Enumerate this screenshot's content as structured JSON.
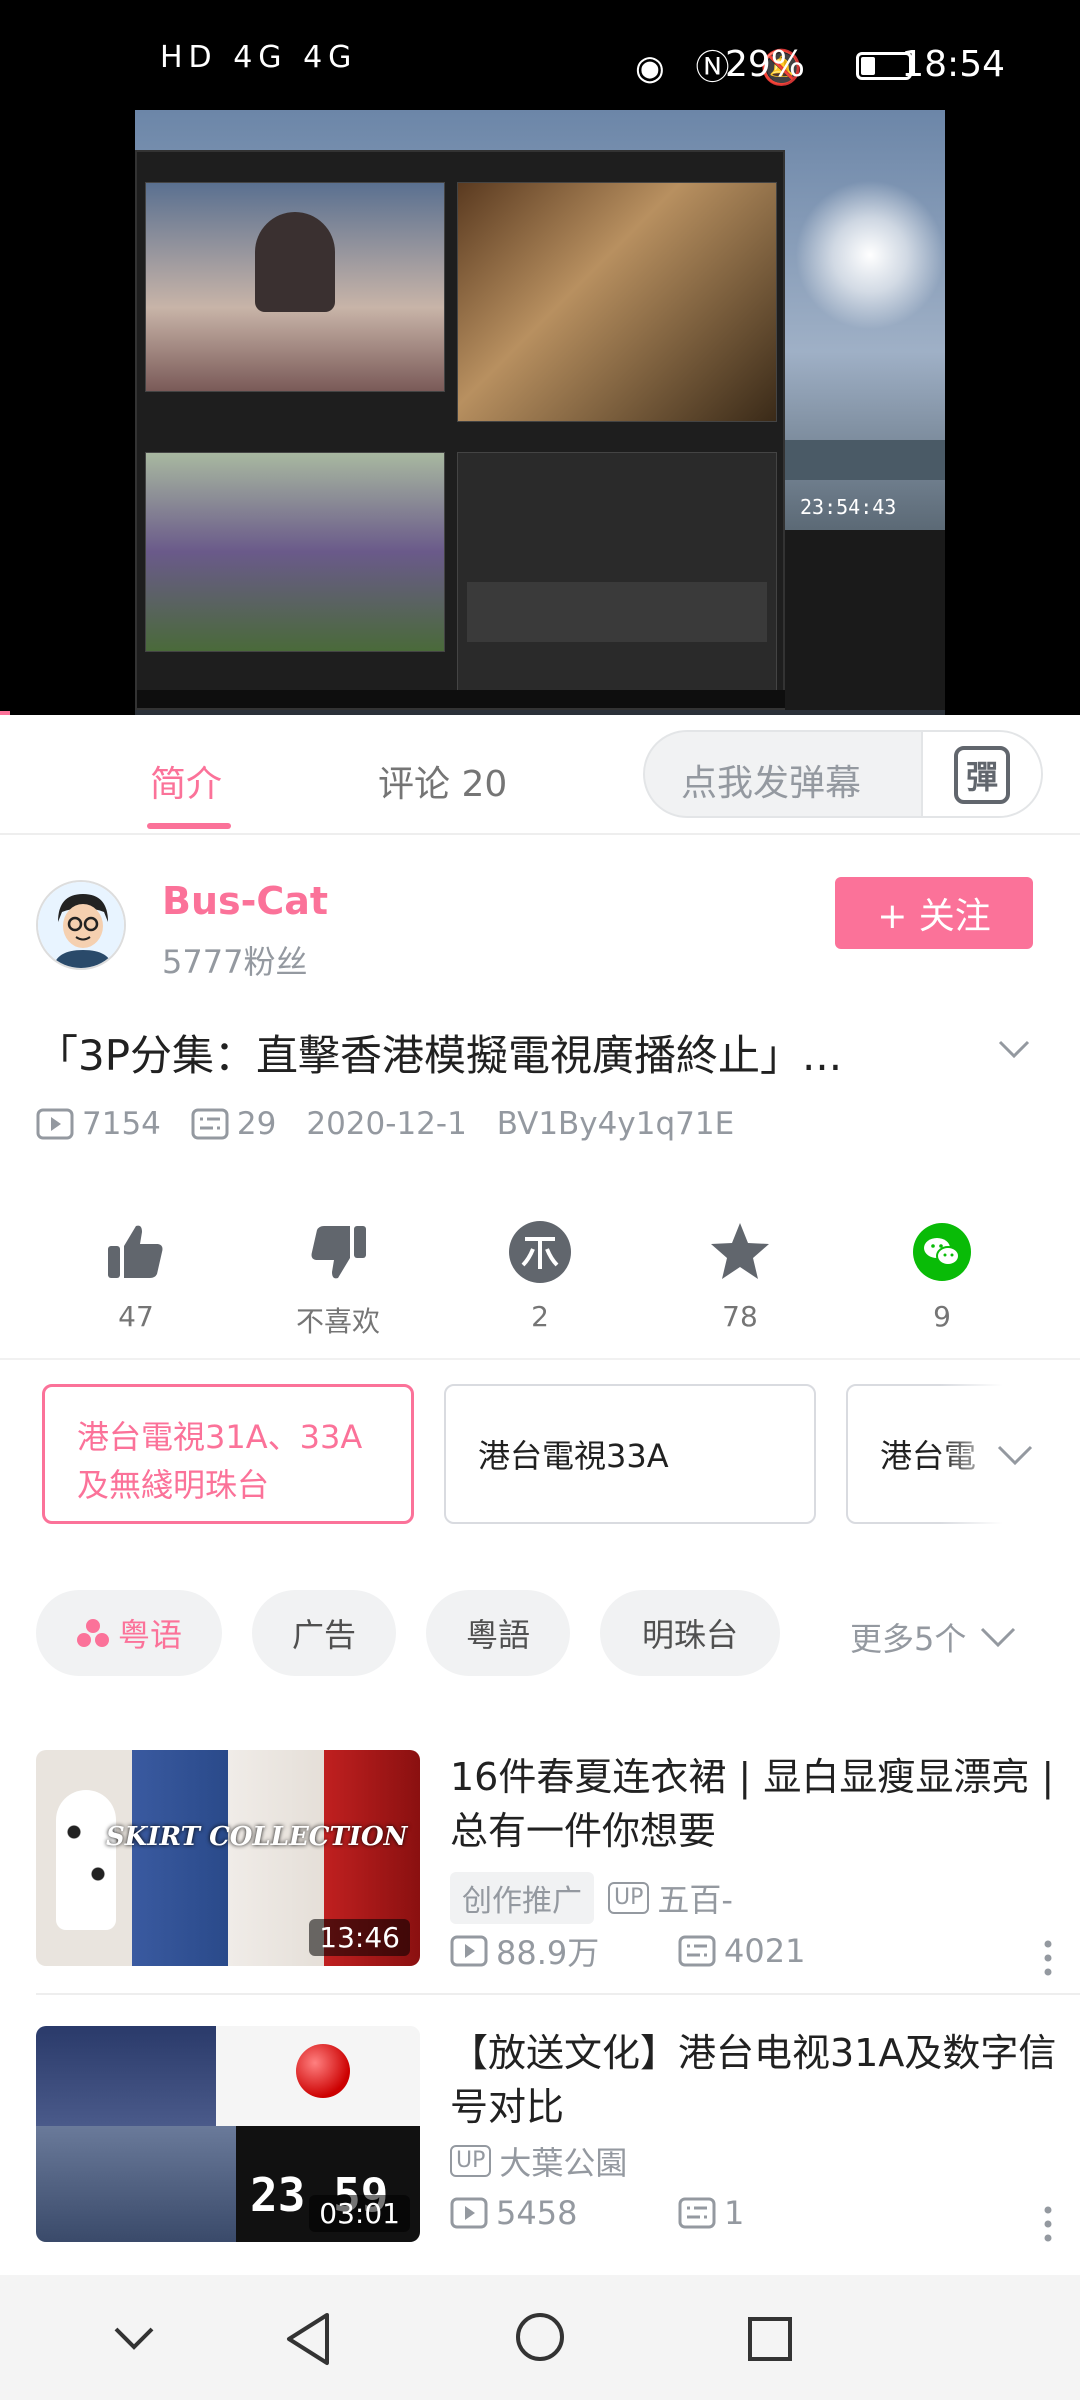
{
  "status_bar": {
    "left_icons": "HD 4G 4G",
    "battery": "29%",
    "time": "18:54"
  },
  "video": {
    "overlay_clock": "23:54:43"
  },
  "tabs": [
    {
      "label": "简介"
    },
    {
      "label": "评论 20"
    }
  ],
  "danmaku": {
    "placeholder": "点我发弹幕",
    "button": "彈"
  },
  "author": {
    "name": "Bus-Cat",
    "fans": "5777粉丝",
    "follow_label": "+ 关注"
  },
  "video_info": {
    "title": "「3P分集：直擊香港模擬電視廣播終止」...",
    "views": "7154",
    "danmaku_count": "29",
    "date": "2020-12-1",
    "bvid": "BV1By4y1q71E"
  },
  "actions": [
    {
      "name": "like",
      "value": "47"
    },
    {
      "name": "dislike",
      "value": "不喜欢"
    },
    {
      "name": "coin",
      "value": "2"
    },
    {
      "name": "favorite",
      "value": "78"
    },
    {
      "name": "share",
      "value": "9"
    }
  ],
  "episodes": [
    {
      "label": "港台電視31A、33A及無綫明珠台"
    },
    {
      "label": "港台電視33A"
    },
    {
      "label": "港台電"
    }
  ],
  "tags": [
    {
      "label": "粤语"
    },
    {
      "label": "广告"
    },
    {
      "label": "粵語"
    },
    {
      "label": "明珠台"
    }
  ],
  "more_tags": "更多5个",
  "recommendations": [
    {
      "title": "16件春夏连衣裙 | 显白显瘦显漂亮 | 总有一件你想要",
      "duration": "13:46",
      "promo": "创作推广",
      "up": "五百-",
      "views": "88.9万",
      "danmaku": "4021",
      "thumb_text": "SKIRT COLLECTION"
    },
    {
      "title": "【放送文化】港台电视31A及数字信号对比",
      "duration": "03:01",
      "up": "大葉公園",
      "views": "5458",
      "danmaku": "1",
      "thumb_text": "23 59 15"
    }
  ],
  "colors": {
    "accent": "#fb7299",
    "muted": "#9499a0",
    "wechat": "#09bb07"
  }
}
